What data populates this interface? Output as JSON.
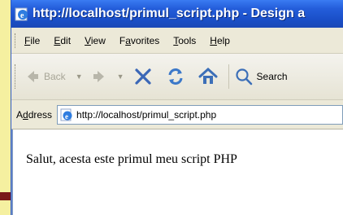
{
  "window": {
    "title": "http://localhost/primul_script.php - Design a"
  },
  "menu": {
    "items": [
      {
        "accel": "F",
        "rest": "ile"
      },
      {
        "accel": "E",
        "rest": "dit"
      },
      {
        "accel": "V",
        "rest": "iew"
      },
      {
        "pre": "F",
        "accel": "a",
        "rest": "vorites"
      },
      {
        "accel": "T",
        "rest": "ools"
      },
      {
        "accel": "H",
        "rest": "elp"
      }
    ]
  },
  "toolbar": {
    "back_label": "Back",
    "search_label": "Search"
  },
  "address": {
    "label_accel": "d",
    "label_pre": "A",
    "label_rest": "dress",
    "url": "http://localhost/primul_script.php"
  },
  "page": {
    "text": "Salut, acesta este primul meu script PHP"
  },
  "colors": {
    "titlebar": "#245edb",
    "background": "#f5f0a0",
    "accent_red": "#8b1a1a"
  }
}
